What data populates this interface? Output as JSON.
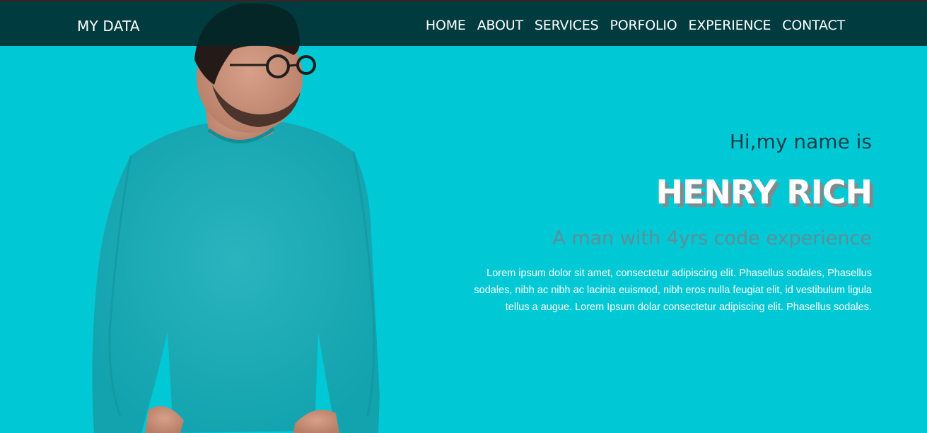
{
  "nav": {
    "brand": "MY DATA",
    "links": [
      "HOME",
      "ABOUT",
      "SERVICES",
      "PORFOLIO",
      "EXPERIENCE",
      "CONTACT"
    ]
  },
  "hero": {
    "greeting": "Hi,my name is",
    "name": "HENRY RICH",
    "tagline": "A man with 4yrs code experience",
    "bio": "Lorem ipsum dolor sit amet, consectetur adipiscing elit. Phasellus sodales, Phasellus sodales, nibh ac nibh ac lacinia euismod, nibh eros nulla feugiat elit, id vestibulum ligula tellus a augue. Lorem Ipsum dolar consectetur adipiscing elit. Phasellus sodales."
  },
  "colors": {
    "background": "#00c9d5",
    "navbar": "#00282a",
    "shirt": "#19adb8",
    "name_shadow": "#7f8b8d",
    "tagline": "#5f8e98"
  },
  "icons": {
    "portrait": "person-portrait-image"
  }
}
